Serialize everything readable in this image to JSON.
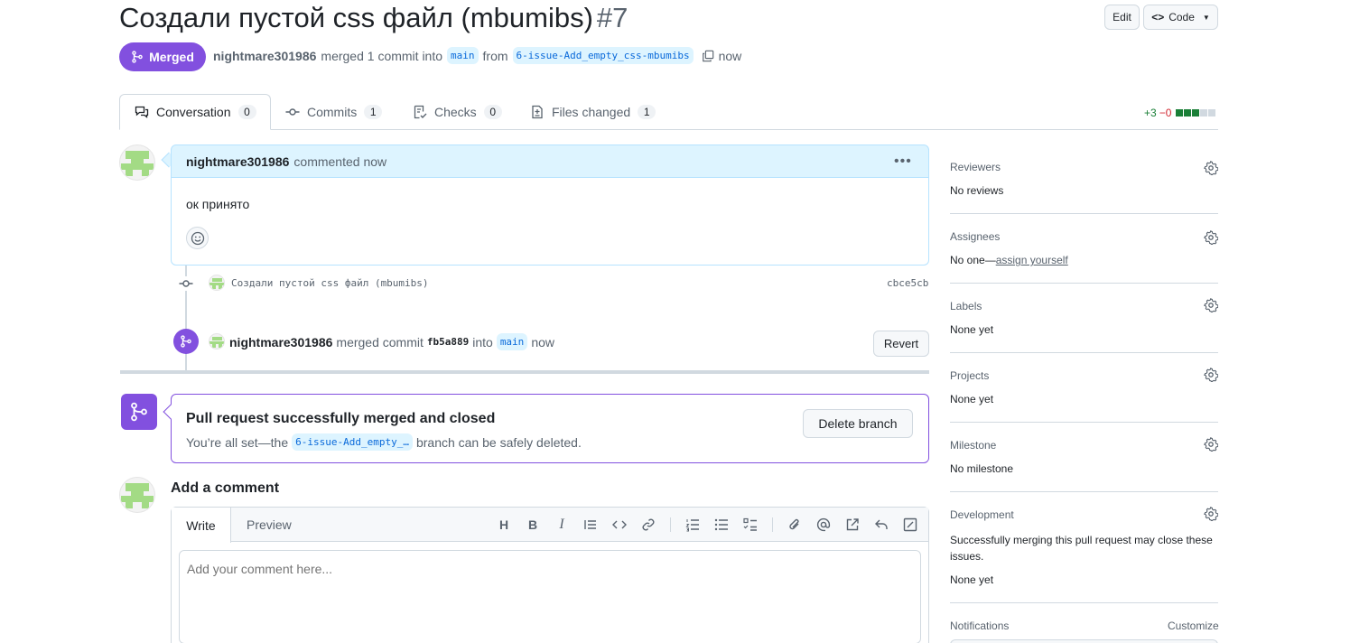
{
  "pr": {
    "title": "Создали пустой css файл (mbumibs)",
    "number": "#7",
    "edit_label": "Edit",
    "code_label": "Code",
    "status": "Merged",
    "author": "nightmare301986",
    "merged_text": "merged 1 commit into",
    "base_branch": "main",
    "from_text": "from",
    "head_branch": "6-issue-Add_empty_css-mbumibs",
    "time": "now"
  },
  "tabs": [
    {
      "label": "Conversation",
      "count": "0",
      "icon": "comment-discussion-icon"
    },
    {
      "label": "Commits",
      "count": "1",
      "icon": "git-commit-icon"
    },
    {
      "label": "Checks",
      "count": "0",
      "icon": "checklist-icon"
    },
    {
      "label": "Files changed",
      "count": "1",
      "icon": "file-diff-icon"
    }
  ],
  "diffstat": {
    "additions": "+3",
    "deletions": "−0",
    "colors": [
      "#1a7f37",
      "#1a7f37",
      "#1a7f37",
      "#d1d9e0",
      "#d1d9e0"
    ]
  },
  "comment": {
    "author": "nightmare301986",
    "action": "commented now",
    "body": "ок принято"
  },
  "commit": {
    "message": "Создали пустой css файл (mbumibs)",
    "sha": "cbce5cb"
  },
  "merge_event": {
    "author": "nightmare301986",
    "text": "merged commit",
    "sha": "fb5a889",
    "into": "into",
    "branch": "main",
    "time": "now",
    "revert_label": "Revert"
  },
  "merged_box": {
    "title": "Pull request successfully merged and closed",
    "sub_prefix": "You’re all set—the",
    "branch": "6-issue-Add_empty_…",
    "sub_suffix": "branch can be safely deleted.",
    "delete_label": "Delete branch"
  },
  "add_comment": {
    "title": "Add a comment",
    "write_tab": "Write",
    "preview_tab": "Preview",
    "placeholder": "Add your comment here..."
  },
  "sidebar": {
    "reviewers": {
      "label": "Reviewers",
      "value": "No reviews"
    },
    "assignees": {
      "label": "Assignees",
      "value_prefix": "No one—",
      "link": "assign yourself"
    },
    "labels": {
      "label": "Labels",
      "value": "None yet"
    },
    "projects": {
      "label": "Projects",
      "value": "None yet"
    },
    "milestone": {
      "label": "Milestone",
      "value": "No milestone"
    },
    "development": {
      "label": "Development",
      "desc": "Successfully merging this pull request may close these issues.",
      "value": "None yet"
    },
    "notifications": {
      "label": "Notifications",
      "customize": "Customize"
    }
  },
  "colors": {
    "merged": "#8250df",
    "accent": "#0969da",
    "comment_header": "#ddf4ff"
  }
}
